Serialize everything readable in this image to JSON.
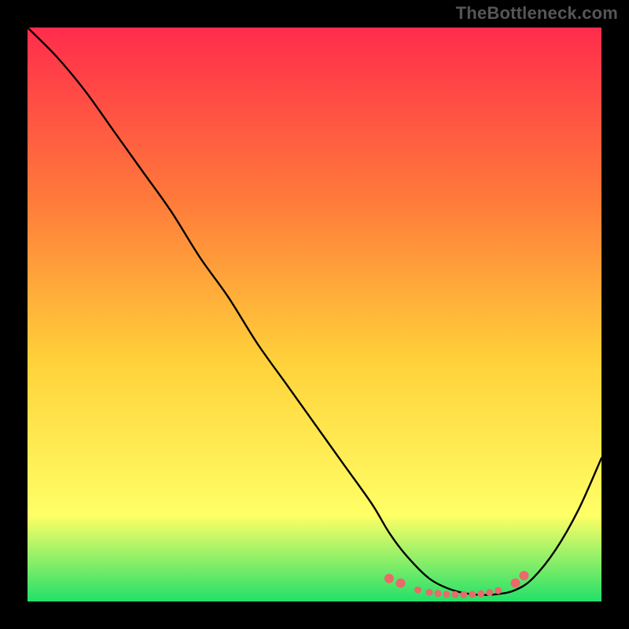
{
  "watermark": "TheBottleneck.com",
  "chart_data": {
    "type": "line",
    "title": "",
    "xlabel": "",
    "ylabel": "",
    "xlim": [
      0,
      100
    ],
    "ylim": [
      0,
      100
    ],
    "grid": false,
    "legend": null,
    "background_gradient": {
      "top": "#ff2c4c",
      "mid1": "#ff7a3a",
      "mid2": "#ffd13a",
      "mid3": "#ffff66",
      "bottom": "#22e06a"
    },
    "series": [
      {
        "name": "curve",
        "color": "#000000",
        "x": [
          0,
          5,
          10,
          15,
          20,
          25,
          30,
          35,
          40,
          45,
          50,
          55,
          60,
          63,
          66,
          70,
          74,
          78,
          82,
          85,
          88,
          92,
          96,
          100
        ],
        "y": [
          100,
          95,
          89,
          82,
          75,
          68,
          60,
          53,
          45,
          38,
          31,
          24,
          17,
          12,
          8,
          4,
          2,
          1.2,
          1.3,
          2,
          4,
          9,
          16,
          25
        ]
      }
    ],
    "highlight_points": {
      "color": "#e86a6a",
      "radius_major": 6,
      "radius_minor": 4.5,
      "points": [
        {
          "x": 63,
          "y": 4.0,
          "r": "major"
        },
        {
          "x": 65,
          "y": 3.2,
          "r": "major"
        },
        {
          "x": 68,
          "y": 2.0,
          "r": "minor"
        },
        {
          "x": 70,
          "y": 1.6,
          "r": "minor"
        },
        {
          "x": 71.5,
          "y": 1.4,
          "r": "minor"
        },
        {
          "x": 73,
          "y": 1.25,
          "r": "minor"
        },
        {
          "x": 74.5,
          "y": 1.2,
          "r": "minor"
        },
        {
          "x": 76,
          "y": 1.2,
          "r": "minor"
        },
        {
          "x": 77.5,
          "y": 1.25,
          "r": "minor"
        },
        {
          "x": 79,
          "y": 1.35,
          "r": "minor"
        },
        {
          "x": 80.5,
          "y": 1.55,
          "r": "minor"
        },
        {
          "x": 82,
          "y": 1.9,
          "r": "minor"
        },
        {
          "x": 85,
          "y": 3.2,
          "r": "major"
        },
        {
          "x": 86.5,
          "y": 4.5,
          "r": "major"
        }
      ]
    }
  }
}
